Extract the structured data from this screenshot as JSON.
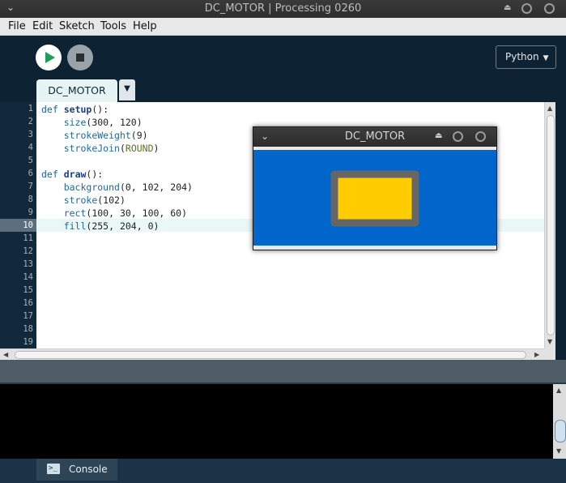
{
  "window": {
    "title": "DC_MOTOR | Processing 0260",
    "chevron_icon": "chevron-down-icon",
    "eject_icon": "⏏"
  },
  "menu": {
    "file": "File",
    "edit": "Edit",
    "sketch": "Sketch",
    "tools": "Tools",
    "help": "Help"
  },
  "toolbar": {
    "run_icon": "play-icon",
    "stop_icon": "stop-icon",
    "mode_label": "Python",
    "mode_arrow": "▼"
  },
  "tabs": {
    "active": "DC_MOTOR",
    "menu_arrow": "▼"
  },
  "editor": {
    "current_line": 10,
    "line_numbers": [
      "1",
      "2",
      "3",
      "4",
      "5",
      "6",
      "7",
      "8",
      "9",
      "10",
      "11",
      "12",
      "13",
      "14",
      "15",
      "16",
      "17",
      "18",
      "19"
    ]
  },
  "sketch_window": {
    "title": "DC_MOTOR",
    "colors": {
      "background": "#0066cc",
      "stroke": "#666666",
      "fill": "#ffcc00"
    }
  },
  "console": {
    "tab_label": "Console",
    "icon_text": ">_"
  }
}
